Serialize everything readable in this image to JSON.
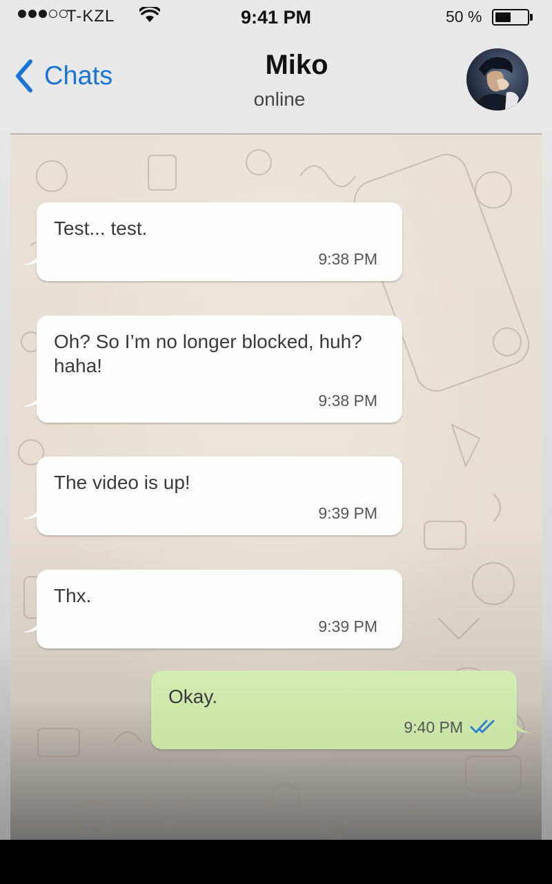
{
  "status_bar": {
    "carrier": "T-KZL",
    "time": "9:41 PM",
    "battery_percent_text": "50 %",
    "battery_level": 0.5,
    "signal_bars_filled": 3,
    "signal_bars_total": 5,
    "icons": [
      "signal-dots-icon",
      "wifi-icon",
      "battery-icon"
    ]
  },
  "nav": {
    "back_label": "Chats",
    "contact_name": "Miko",
    "contact_status": "online",
    "icons": [
      "chevron-left-icon",
      "avatar"
    ]
  },
  "messages": [
    {
      "direction": "in",
      "text": "Test... test.",
      "time": "9:38 PM"
    },
    {
      "direction": "in",
      "text": "Oh? So I’m no longer blocked, huh? haha!",
      "time": "9:38 PM"
    },
    {
      "direction": "in",
      "text": "The video is up!",
      "time": "9:39 PM"
    },
    {
      "direction": "in",
      "text": "Thx.",
      "time": "9:39 PM"
    },
    {
      "direction": "out",
      "text": "Okay.",
      "time": "9:40 PM",
      "status": "read-double-check-icon"
    }
  ],
  "colors": {
    "accent": "#1875d6",
    "outgoing_bubble": "#cfe7ad",
    "incoming_bubble": "#fdfdfd",
    "read_ticks": "#2e7fd1"
  }
}
